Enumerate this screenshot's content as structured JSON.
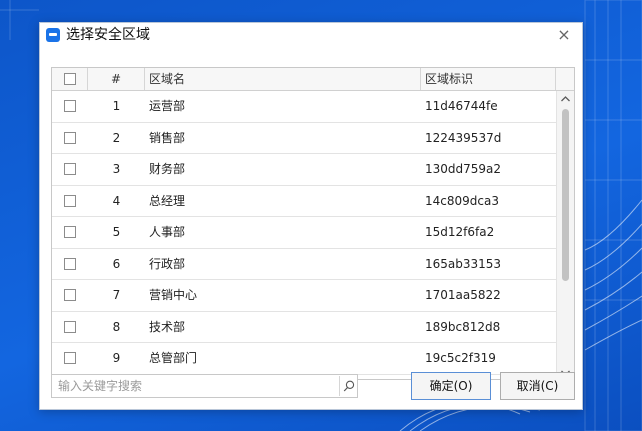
{
  "window": {
    "title": "选择安全区域",
    "close_glyph": "×"
  },
  "table": {
    "headers": {
      "num": "#",
      "name": "区域名",
      "id": "区域标识"
    },
    "rows": [
      {
        "num": "1",
        "name": "运营部",
        "id": "11d46744fe"
      },
      {
        "num": "2",
        "name": "销售部",
        "id": "122439537d"
      },
      {
        "num": "3",
        "name": "财务部",
        "id": "130dd759a2"
      },
      {
        "num": "4",
        "name": "总经理",
        "id": "14c809dca3"
      },
      {
        "num": "5",
        "name": "人事部",
        "id": "15d12f6fa2"
      },
      {
        "num": "6",
        "name": "行政部",
        "id": "165ab33153"
      },
      {
        "num": "7",
        "name": "营销中心",
        "id": "1701aa5822"
      },
      {
        "num": "8",
        "name": "技术部",
        "id": "189bc812d8"
      },
      {
        "num": "9",
        "name": "总管部门",
        "id": "19c5c2f319"
      }
    ]
  },
  "search": {
    "placeholder": "输入关键字搜索",
    "value": ""
  },
  "buttons": {
    "ok": "确定(O)",
    "cancel": "取消(C)"
  },
  "icons": {
    "app": "app-logo-icon",
    "close": "close-icon",
    "search": "search-icon",
    "scroll_up": "scroll-up-icon",
    "scroll_down": "scroll-down-icon"
  },
  "colors": {
    "background": "#1366e0",
    "app_icon": "#1a73e8",
    "ok_border": "#5a8fd6"
  }
}
